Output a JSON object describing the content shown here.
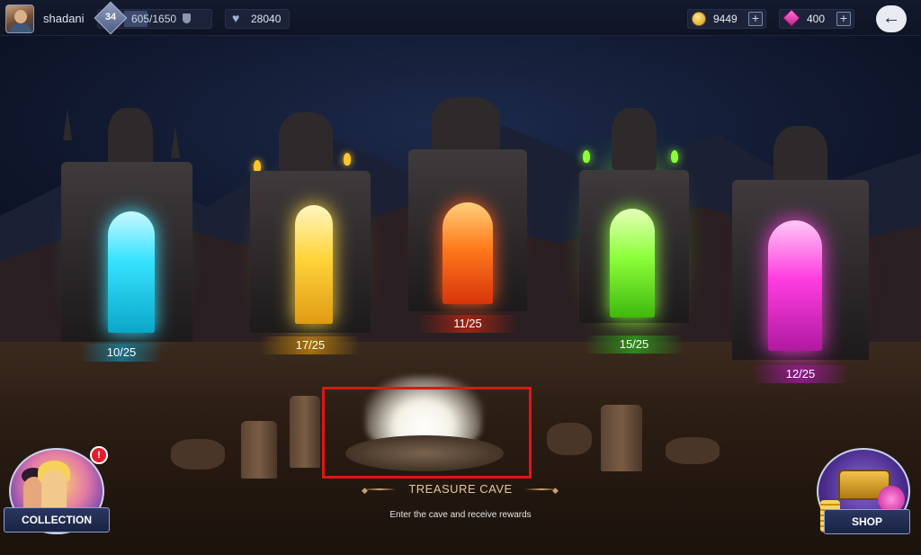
{
  "player": {
    "name": "shadani",
    "level": "34",
    "xp": "605/1650",
    "hearts": "28040"
  },
  "currencies": {
    "coins": "9449",
    "gems": "400"
  },
  "icons": {
    "back": "arrow-left-icon",
    "coin": "coin-icon",
    "gem": "gem-icon",
    "plus": "plus-icon",
    "heart": "heart-icon",
    "shield": "shield-icon"
  },
  "portals": [
    {
      "progress": "10/25",
      "color": "#38e3ff"
    },
    {
      "progress": "17/25",
      "color": "#ffd43a"
    },
    {
      "progress": "11/25",
      "color": "#ff5a1c"
    },
    {
      "progress": "15/25",
      "color": "#8cff3a"
    },
    {
      "progress": "12/25",
      "color": "#ff3ce0"
    }
  ],
  "cave": {
    "title": "TREASURE CAVE",
    "subtitle": "Enter the cave and receive rewards"
  },
  "buttons": {
    "collection": "COLLECTION",
    "collection_badge": "!",
    "shop": "SHOP"
  }
}
